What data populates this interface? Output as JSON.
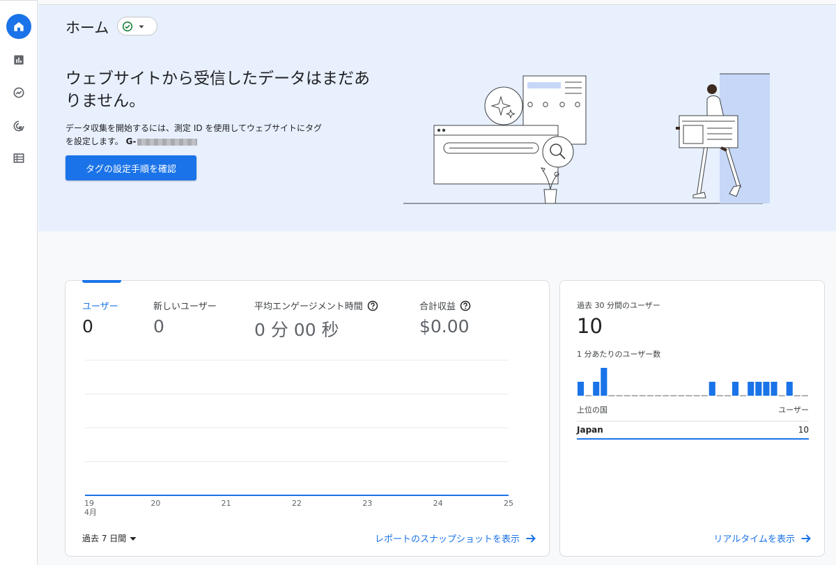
{
  "nav": {
    "items": [
      {
        "name": "home-icon",
        "label": "Home",
        "active": true
      },
      {
        "name": "reports-icon",
        "label": "Reports",
        "active": false
      },
      {
        "name": "explore-icon",
        "label": "Explore",
        "active": false
      },
      {
        "name": "advertising-icon",
        "label": "Advertising",
        "active": false
      },
      {
        "name": "configure-icon",
        "label": "Configure",
        "active": false
      }
    ]
  },
  "header": {
    "title": "ホーム"
  },
  "hero": {
    "heading": "ウェブサイトから受信したデータはまだありません。",
    "desc_line1": "データ収集を開始するには、測定 ID を使用してウェブサイトにタグ",
    "desc_line2": "を設定します。",
    "measurement_prefix": "G-",
    "cta_label": "タグの設定手順を確認"
  },
  "metrics": [
    {
      "label": "ユーザー",
      "value": "0",
      "active": true,
      "help": false
    },
    {
      "label": "新しいユーザー",
      "value": "0",
      "active": false,
      "help": false
    },
    {
      "label": "平均エンゲージメント時間",
      "value": "0 分 00 秒",
      "active": false,
      "help": true
    },
    {
      "label": "合計収益",
      "value": "$0.00",
      "active": false,
      "help": true
    }
  ],
  "chart_data": {
    "type": "line",
    "categories": [
      "19",
      "20",
      "21",
      "22",
      "23",
      "24",
      "25"
    ],
    "month_label": "4月",
    "series": [
      {
        "values": [
          0,
          0,
          0,
          0,
          0,
          0,
          0
        ]
      }
    ],
    "gridlines": 4,
    "grid": true
  },
  "footer_main": {
    "range_label": "過去 7 日間",
    "link_label": "レポートのスナップショットを表示"
  },
  "realtime": {
    "title": "過去 30 分間のユーザー",
    "value": "10",
    "subtitle": "1 分あたりのユーザー数",
    "bars": [
      1,
      0,
      1,
      2,
      0,
      0,
      0,
      0,
      0,
      0,
      0,
      0,
      0,
      0,
      0,
      0,
      0,
      1,
      0,
      0,
      1,
      0,
      1,
      1,
      1,
      1,
      0,
      1,
      0,
      0
    ],
    "col_country": "上位の国",
    "col_users": "ユーザー",
    "rows": [
      {
        "country": "Japan",
        "users": "10"
      }
    ],
    "link_label": "リアルタイムを表示"
  },
  "colors": {
    "accent": "#1a73e8",
    "hero_bg": "#e8f0fe",
    "success": "#188038"
  }
}
